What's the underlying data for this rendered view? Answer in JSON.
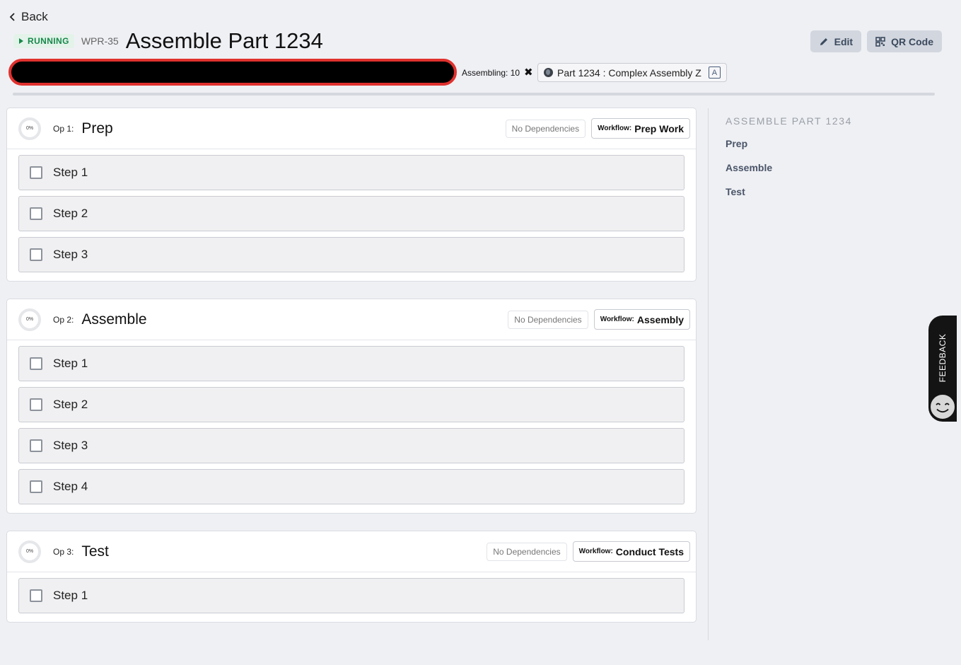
{
  "nav": {
    "back_label": "Back"
  },
  "header": {
    "status": "RUNNING",
    "wpr_id": "WPR-35",
    "title": "Assemble Part 1234"
  },
  "actions": {
    "edit_label": "Edit",
    "qr_label": "QR Code"
  },
  "assembling": {
    "label": "Assembling: 10",
    "remove_glyph": "✖"
  },
  "part": {
    "label": "Part 1234 : Complex Assembly Z",
    "revision": "A"
  },
  "overall_progress": 0,
  "operations": [
    {
      "progress": "0%",
      "op_label": "Op 1:",
      "name": "Prep",
      "dependencies": "No Dependencies",
      "workflow_key": "Workflow:",
      "workflow": "Prep Work",
      "steps": [
        "Step 1",
        "Step 2",
        "Step 3"
      ]
    },
    {
      "progress": "0%",
      "op_label": "Op 2:",
      "name": "Assemble",
      "dependencies": "No Dependencies",
      "workflow_key": "Workflow:",
      "workflow": "Assembly",
      "steps": [
        "Step 1",
        "Step 2",
        "Step 3",
        "Step 4"
      ]
    },
    {
      "progress": "0%",
      "op_label": "Op 3:",
      "name": "Test",
      "dependencies": "No Dependencies",
      "workflow_key": "Workflow:",
      "workflow": "Conduct Tests",
      "steps": [
        "Step 1"
      ]
    }
  ],
  "toc": {
    "title": "ASSEMBLE PART 1234",
    "items": [
      "Prep",
      "Assemble",
      "Test"
    ]
  },
  "feedback": {
    "label": "FEEDBACK"
  }
}
